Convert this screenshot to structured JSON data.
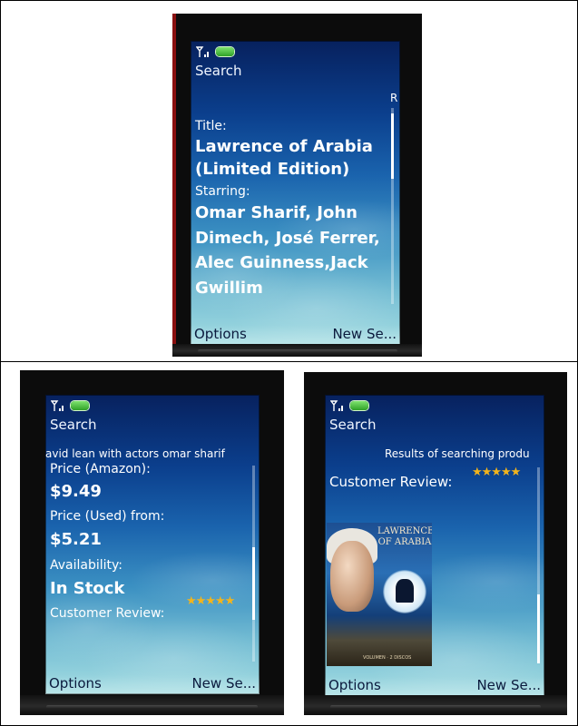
{
  "screens": [
    {
      "header": "Search",
      "ticker": "R",
      "fields": [
        {
          "label": "Title:",
          "value": "Lawrence of Arabia (Limited Edition)"
        },
        {
          "label": "Starring:",
          "value": "Omar Sharif, John Dimech, José Ferrer, Alec Guinness,Jack Gwillim"
        }
      ],
      "softkeys": {
        "left": "Options",
        "right": "New Se..."
      }
    },
    {
      "header": "Search",
      "ticker": "avid lean with actors omar sharif",
      "fields": [
        {
          "label": "Price (Amazon):",
          "value": "$9.49"
        },
        {
          "label": "Price (Used) from:",
          "value": "$5.21"
        },
        {
          "label": "Availability:",
          "value": "In Stock"
        }
      ],
      "review_label": "Customer Review:",
      "rating": {
        "value": 5,
        "max": 5,
        "glyph": "★★★★★"
      },
      "softkeys": {
        "left": "Options",
        "right": "New Se..."
      }
    },
    {
      "header": "Search",
      "ticker": "Results of searching produ",
      "review_label": "Customer Review:",
      "rating": {
        "value": 5,
        "max": 5,
        "glyph": "★★★★★"
      },
      "poster": {
        "title": "LAWRENCE OF ARABIA",
        "caption": "VOLUMEN · 2 DISCOS"
      },
      "softkeys": {
        "left": "Options",
        "right": "New Se..."
      }
    }
  ],
  "colors": {
    "screen_top": "#07215e",
    "screen_bottom": "#a4dde2",
    "star": "#f3b41c",
    "softkey_text": "#0b1a3d"
  }
}
